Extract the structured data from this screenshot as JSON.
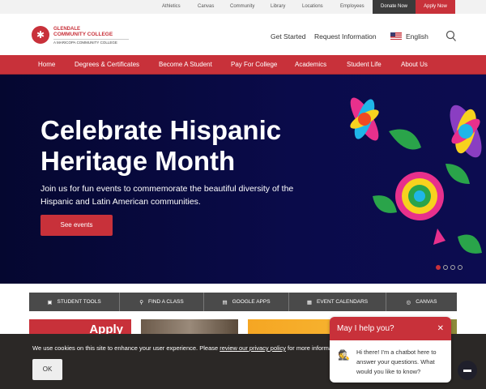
{
  "utility_nav": [
    "Athletics",
    "Canvas",
    "Community",
    "Library",
    "Locations",
    "Employees"
  ],
  "donate": "Donate Now",
  "apply": "Apply Now",
  "logo": {
    "line1": "GLENDALE",
    "line2": "COMMUNITY COLLEGE",
    "line3": "A MARICOPA COMMUNITY COLLEGE"
  },
  "header_links": {
    "get_started": "Get Started",
    "request_info": "Request Information",
    "language": "English"
  },
  "main_nav": [
    "Home",
    "Degrees & Certificates",
    "Become A Student",
    "Pay For College",
    "Academics",
    "Student Life",
    "About Us"
  ],
  "hero": {
    "title": "Celebrate Hispanic Heritage Month",
    "subtitle": "Join us for fun events to commemorate the beautiful diversity of the Hispanic and Latin American communities.",
    "button": "See events",
    "slide_count": 4,
    "active_slide": 1
  },
  "quick_links": [
    "STUDENT TOOLS",
    "FIND A CLASS",
    "GOOGLE APPS",
    "EVENT CALENDARS",
    "CANVAS"
  ],
  "card_text": "Apply",
  "cookie": {
    "text": "We use cookies on this site to enhance your user experience. Please ",
    "link": "review our privacy policy",
    "text_after": " for more informa",
    "ok": "OK"
  },
  "chat": {
    "title": "May I help you?",
    "message": "Hi there! I'm a chatbot here to answer your questions. What would you like to know?"
  },
  "colors": {
    "brand_red": "#c8313a",
    "hero_bg": "#0a0b4a"
  }
}
